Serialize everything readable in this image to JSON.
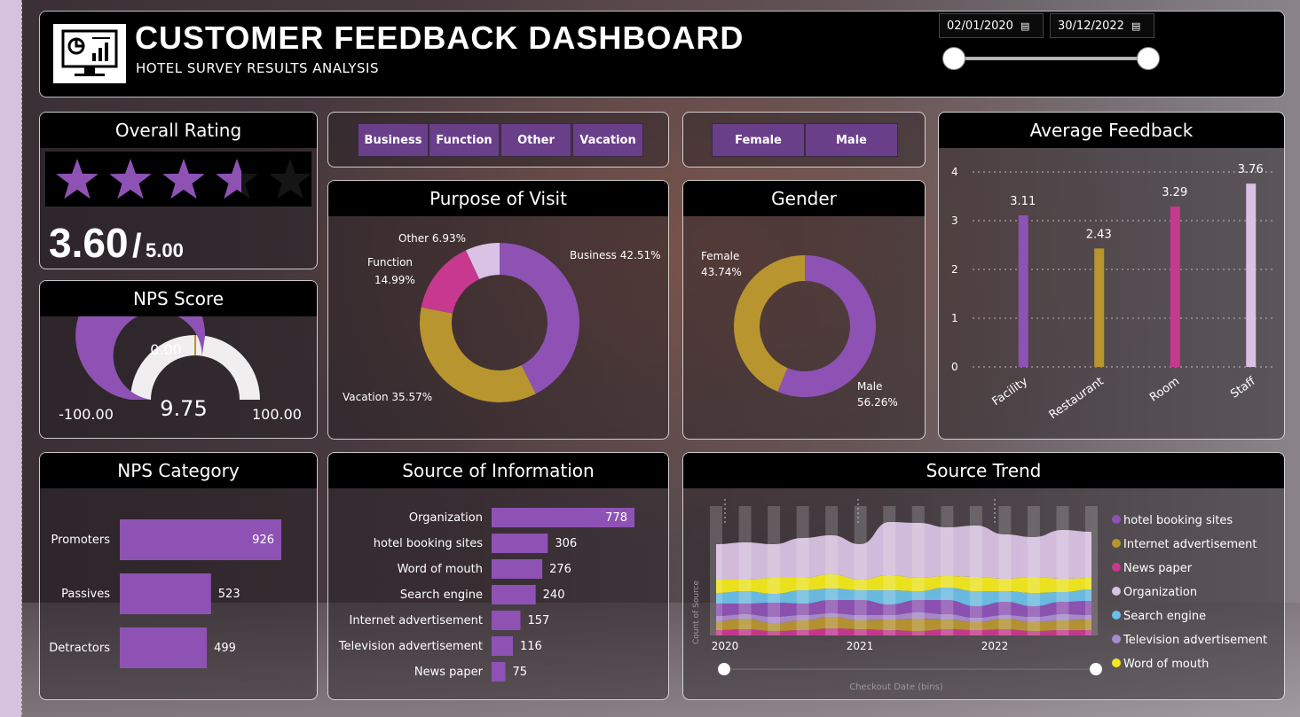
{
  "header": {
    "title": "CUSTOMER FEEDBACK DASHBOARD",
    "subtitle": "HOTEL SURVEY RESULTS ANALYSIS",
    "date_start": "02/01/2020",
    "date_end": "30/12/2022",
    "logo_icon": "monitor-chart-icon",
    "calendar_icon": "calendar-icon"
  },
  "overall_rating": {
    "title": "Overall Rating",
    "value": "3.60",
    "separator": "/",
    "max": "5.00",
    "stars_total": 5,
    "stars_filled": 3.6,
    "star_color": "#8e52b5"
  },
  "nps_score": {
    "title": "NPS Score",
    "value": "9.75",
    "target": "0.00",
    "min": "-100.00",
    "max": "100.00",
    "fill_color": "#8e52b5"
  },
  "purpose_filter": {
    "buttons": [
      "Business",
      "Function",
      "Other",
      "Vacation"
    ]
  },
  "gender_filter": {
    "buttons": [
      "Female",
      "Male"
    ]
  },
  "purpose_of_visit": {
    "title": "Purpose of Visit",
    "chart_data": {
      "type": "pie",
      "labels": [
        "Business",
        "Vacation",
        "Function",
        "Other"
      ],
      "values": [
        42.51,
        35.57,
        14.99,
        6.93
      ],
      "colors": [
        "#8e52b5",
        "#b8952f",
        "#c6398f",
        "#d9c2e3"
      ],
      "label_text": [
        "Business 42.51%",
        "Vacation 35.57%",
        "Function",
        "14.99%",
        "Other 6.93%"
      ]
    }
  },
  "gender": {
    "title": "Gender",
    "chart_data": {
      "type": "pie",
      "labels": [
        "Male",
        "Female"
      ],
      "values": [
        56.26,
        43.74
      ],
      "colors": [
        "#8e52b5",
        "#b8952f"
      ],
      "label_text": [
        "Female",
        "43.74%",
        "Male",
        "56.26%"
      ]
    }
  },
  "average_feedback": {
    "title": "Average Feedback",
    "chart_data": {
      "type": "bar",
      "categories": [
        "Facility",
        "Restaurant",
        "Room",
        "Staff"
      ],
      "values": [
        3.11,
        2.43,
        3.29,
        3.76
      ],
      "value_labels": [
        "3.11",
        "2.43",
        "3.29",
        "3.76"
      ],
      "colors": [
        "#8e52b5",
        "#b8952f",
        "#c6398f",
        "#d9c2e3"
      ],
      "ylim": [
        0,
        4
      ],
      "yticks": [
        "0",
        "1",
        "2",
        "3",
        "4"
      ],
      "grid": true
    }
  },
  "nps_category": {
    "title": "NPS Category",
    "chart_data": {
      "type": "bar",
      "orientation": "horizontal",
      "categories": [
        "Promoters",
        "Passives",
        "Detractors"
      ],
      "values": [
        926,
        523,
        499
      ],
      "value_labels": [
        "926",
        "523",
        "499"
      ],
      "color": "#8e52b5"
    }
  },
  "source_of_information": {
    "title": "Source of Information",
    "chart_data": {
      "type": "bar",
      "orientation": "horizontal",
      "categories": [
        "Organization",
        "hotel booking sites",
        "Word of mouth",
        "Search engine",
        "Internet advertisement",
        "Television advertisement",
        "News paper"
      ],
      "values": [
        778,
        306,
        276,
        240,
        157,
        116,
        75
      ],
      "value_labels": [
        "778",
        "306",
        "276",
        "240",
        "157",
        "116",
        "75"
      ],
      "color": "#8e52b5"
    }
  },
  "source_trend": {
    "title": "Source Trend",
    "chart_data": {
      "type": "area",
      "stacked": true,
      "x_ticks": [
        "2020",
        "2021",
        "2022"
      ],
      "xlabel": "Checkout Date (bins)",
      "ylabel": "Count of Source",
      "legend_position": "right",
      "series": [
        {
          "name": "hotel booking sites",
          "color": "#8e52b5"
        },
        {
          "name": "Internet advertisement",
          "color": "#b8952f"
        },
        {
          "name": "News paper",
          "color": "#c6398f"
        },
        {
          "name": "Organization",
          "color": "#d9c2e3"
        },
        {
          "name": "Search engine",
          "color": "#6cc0e8"
        },
        {
          "name": "Television advertisement",
          "color": "#a98bd0"
        },
        {
          "name": "Word of mouth",
          "color": "#f3ea1c"
        }
      ]
    }
  }
}
